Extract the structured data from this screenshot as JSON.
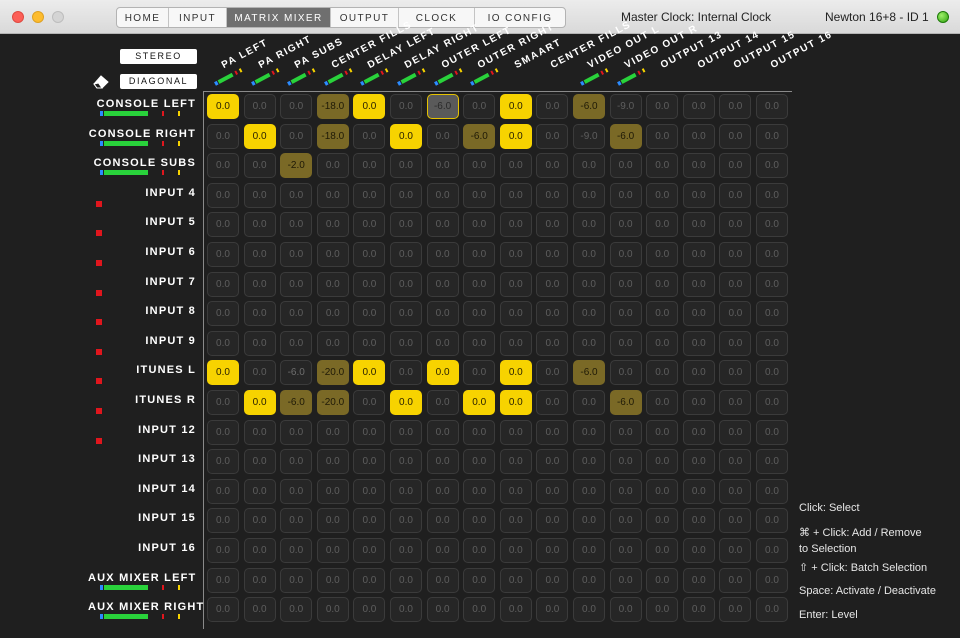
{
  "window": {
    "tabs": [
      "HOME",
      "INPUT",
      "MATRIX MIXER",
      "OUTPUT",
      "CLOCK",
      "IO CONFIG"
    ],
    "active_tab": "MATRIX MIXER",
    "master_clock": "Master Clock: Internal Clock",
    "device": "Newton 16+8 - ID 1"
  },
  "controls": {
    "stereo_label": "STEREO",
    "diagonal_label": "DIAGONAL"
  },
  "columns": [
    "PA LEFT",
    "PA RIGHT",
    "PA SUBS",
    "CENTER FILLS",
    "DELAY LEFT",
    "DELAY RIGHT",
    "OUTER LEFT",
    "OUTER RIGHT",
    "SMAART",
    "CENTER FILLS",
    "VIDEO OUT L",
    "VIDEO OUT R",
    "OUTPUT 13",
    "OUTPUT 14",
    "OUTPUT 15",
    "OUTPUT 16"
  ],
  "column_meters": [
    1,
    1,
    1,
    1,
    1,
    1,
    1,
    1,
    0,
    0,
    1,
    1,
    0,
    0,
    0,
    0
  ],
  "rows": [
    {
      "label": "CONSOLE LEFT",
      "meter": true,
      "mute": false,
      "cells": [
        "0.0",
        "0.0",
        "0.0",
        "-18.0",
        "0.0",
        "0.0",
        "-6.0",
        "0.0",
        "0.0",
        "0.0",
        "-6.0",
        "-9.0",
        "0.0",
        "0.0",
        "0.0",
        "0.0"
      ],
      "states": [
        "on",
        "",
        "",
        "dim",
        "on",
        "",
        "selgrey",
        "",
        "on",
        "",
        "dim",
        "",
        "",
        "",
        "",
        ""
      ]
    },
    {
      "label": "CONSOLE RIGHT",
      "meter": true,
      "mute": false,
      "cells": [
        "0.0",
        "0.0",
        "0.0",
        "-18.0",
        "0.0",
        "0.0",
        "0.0",
        "-6.0",
        "0.0",
        "0.0",
        "-9.0",
        "-6.0",
        "0.0",
        "0.0",
        "0.0",
        "0.0"
      ],
      "states": [
        "",
        "on",
        "",
        "dim",
        "",
        "on",
        "",
        "dim",
        "on",
        "",
        "",
        "dim",
        "",
        "",
        "",
        ""
      ]
    },
    {
      "label": "CONSOLE SUBS",
      "meter": true,
      "mute": false,
      "cells": [
        "0.0",
        "0.0",
        "-2.0",
        "0.0",
        "0.0",
        "0.0",
        "0.0",
        "0.0",
        "0.0",
        "0.0",
        "0.0",
        "0.0",
        "0.0",
        "0.0",
        "0.0",
        "0.0"
      ],
      "states": [
        "",
        "",
        "dim",
        "",
        "",
        "",
        "",
        "",
        "",
        "",
        "",
        "",
        "",
        "",
        "",
        ""
      ]
    },
    {
      "label": "INPUT 4",
      "meter": false,
      "mute": true,
      "cells": [
        "0.0",
        "0.0",
        "0.0",
        "0.0",
        "0.0",
        "0.0",
        "0.0",
        "0.0",
        "0.0",
        "0.0",
        "0.0",
        "0.0",
        "0.0",
        "0.0",
        "0.0",
        "0.0"
      ],
      "states": [
        "",
        "",
        "",
        "",
        "",
        "",
        "",
        "",
        "",
        "",
        "",
        "",
        "",
        "",
        "",
        ""
      ]
    },
    {
      "label": "INPUT 5",
      "meter": false,
      "mute": true,
      "cells": [
        "0.0",
        "0.0",
        "0.0",
        "0.0",
        "0.0",
        "0.0",
        "0.0",
        "0.0",
        "0.0",
        "0.0",
        "0.0",
        "0.0",
        "0.0",
        "0.0",
        "0.0",
        "0.0"
      ],
      "states": [
        "",
        "",
        "",
        "",
        "",
        "",
        "",
        "",
        "",
        "",
        "",
        "",
        "",
        "",
        "",
        ""
      ]
    },
    {
      "label": "INPUT 6",
      "meter": false,
      "mute": true,
      "cells": [
        "0.0",
        "0.0",
        "0.0",
        "0.0",
        "0.0",
        "0.0",
        "0.0",
        "0.0",
        "0.0",
        "0.0",
        "0.0",
        "0.0",
        "0.0",
        "0.0",
        "0.0",
        "0.0"
      ],
      "states": [
        "",
        "",
        "",
        "",
        "",
        "",
        "",
        "",
        "",
        "",
        "",
        "",
        "",
        "",
        "",
        ""
      ]
    },
    {
      "label": "INPUT 7",
      "meter": false,
      "mute": true,
      "cells": [
        "0.0",
        "0.0",
        "0.0",
        "0.0",
        "0.0",
        "0.0",
        "0.0",
        "0.0",
        "0.0",
        "0.0",
        "0.0",
        "0.0",
        "0.0",
        "0.0",
        "0.0",
        "0.0"
      ],
      "states": [
        "",
        "",
        "",
        "",
        "",
        "",
        "",
        "",
        "",
        "",
        "",
        "",
        "",
        "",
        "",
        ""
      ]
    },
    {
      "label": "INPUT 8",
      "meter": false,
      "mute": true,
      "cells": [
        "0.0",
        "0.0",
        "0.0",
        "0.0",
        "0.0",
        "0.0",
        "0.0",
        "0.0",
        "0.0",
        "0.0",
        "0.0",
        "0.0",
        "0.0",
        "0.0",
        "0.0",
        "0.0"
      ],
      "states": [
        "",
        "",
        "",
        "",
        "",
        "",
        "",
        "",
        "",
        "",
        "",
        "",
        "",
        "",
        "",
        ""
      ]
    },
    {
      "label": "INPUT 9",
      "meter": false,
      "mute": true,
      "cells": [
        "0.0",
        "0.0",
        "0.0",
        "0.0",
        "0.0",
        "0.0",
        "0.0",
        "0.0",
        "0.0",
        "0.0",
        "0.0",
        "0.0",
        "0.0",
        "0.0",
        "0.0",
        "0.0"
      ],
      "states": [
        "",
        "",
        "",
        "",
        "",
        "",
        "",
        "",
        "",
        "",
        "",
        "",
        "",
        "",
        "",
        ""
      ]
    },
    {
      "label": "ITUNES L",
      "meter": false,
      "mute": true,
      "cells": [
        "0.0",
        "0.0",
        "-6.0",
        "-20.0",
        "0.0",
        "0.0",
        "0.0",
        "0.0",
        "0.0",
        "0.0",
        "-6.0",
        "0.0",
        "0.0",
        "0.0",
        "0.0",
        "0.0"
      ],
      "states": [
        "on",
        "",
        "grey",
        "dim",
        "on",
        "",
        "on",
        "",
        "on",
        "",
        "dim",
        "",
        "",
        "",
        "",
        ""
      ]
    },
    {
      "label": "ITUNES R",
      "meter": false,
      "mute": true,
      "cells": [
        "0.0",
        "0.0",
        "-6.0",
        "-20.0",
        "0.0",
        "0.0",
        "0.0",
        "0.0",
        "0.0",
        "0.0",
        "0.0",
        "-6.0",
        "0.0",
        "0.0",
        "0.0",
        "0.0"
      ],
      "states": [
        "",
        "on",
        "dim",
        "dim",
        "",
        "on",
        "",
        "on",
        "on",
        "",
        "",
        "dim",
        "",
        "",
        "",
        ""
      ]
    },
    {
      "label": "INPUT 12",
      "meter": false,
      "mute": true,
      "cells": [
        "0.0",
        "0.0",
        "0.0",
        "0.0",
        "0.0",
        "0.0",
        "0.0",
        "0.0",
        "0.0",
        "0.0",
        "0.0",
        "0.0",
        "0.0",
        "0.0",
        "0.0",
        "0.0"
      ],
      "states": [
        "",
        "",
        "",
        "",
        "",
        "",
        "",
        "",
        "",
        "",
        "",
        "",
        "",
        "",
        "",
        ""
      ]
    },
    {
      "label": "INPUT 13",
      "meter": false,
      "mute": false,
      "cells": [
        "0.0",
        "0.0",
        "0.0",
        "0.0",
        "0.0",
        "0.0",
        "0.0",
        "0.0",
        "0.0",
        "0.0",
        "0.0",
        "0.0",
        "0.0",
        "0.0",
        "0.0",
        "0.0"
      ],
      "states": [
        "",
        "",
        "",
        "",
        "",
        "",
        "",
        "",
        "",
        "",
        "",
        "",
        "",
        "",
        "",
        ""
      ]
    },
    {
      "label": "INPUT 14",
      "meter": false,
      "mute": false,
      "cells": [
        "0.0",
        "0.0",
        "0.0",
        "0.0",
        "0.0",
        "0.0",
        "0.0",
        "0.0",
        "0.0",
        "0.0",
        "0.0",
        "0.0",
        "0.0",
        "0.0",
        "0.0",
        "0.0"
      ],
      "states": [
        "",
        "",
        "",
        "",
        "",
        "",
        "",
        "",
        "",
        "",
        "",
        "",
        "",
        "",
        "",
        ""
      ]
    },
    {
      "label": "INPUT 15",
      "meter": false,
      "mute": false,
      "cells": [
        "0.0",
        "0.0",
        "0.0",
        "0.0",
        "0.0",
        "0.0",
        "0.0",
        "0.0",
        "0.0",
        "0.0",
        "0.0",
        "0.0",
        "0.0",
        "0.0",
        "0.0",
        "0.0"
      ],
      "states": [
        "",
        "",
        "",
        "",
        "",
        "",
        "",
        "",
        "",
        "",
        "",
        "",
        "",
        "",
        "",
        ""
      ]
    },
    {
      "label": "INPUT 16",
      "meter": false,
      "mute": false,
      "cells": [
        "0.0",
        "0.0",
        "0.0",
        "0.0",
        "0.0",
        "0.0",
        "0.0",
        "0.0",
        "0.0",
        "0.0",
        "0.0",
        "0.0",
        "0.0",
        "0.0",
        "0.0",
        "0.0"
      ],
      "states": [
        "",
        "",
        "",
        "",
        "",
        "",
        "",
        "",
        "",
        "",
        "",
        "",
        "",
        "",
        "",
        ""
      ]
    },
    {
      "label": "AUX MIXER LEFT",
      "meter": true,
      "mute": false,
      "cells": [
        "0.0",
        "0.0",
        "0.0",
        "0.0",
        "0.0",
        "0.0",
        "0.0",
        "0.0",
        "0.0",
        "0.0",
        "0.0",
        "0.0",
        "0.0",
        "0.0",
        "0.0",
        "0.0"
      ],
      "states": [
        "",
        "",
        "",
        "",
        "",
        "",
        "",
        "",
        "",
        "",
        "",
        "",
        "",
        "",
        "",
        ""
      ]
    },
    {
      "label": "AUX MIXER RIGHT",
      "meter": true,
      "mute": false,
      "cells": [
        "0.0",
        "0.0",
        "0.0",
        "0.0",
        "0.0",
        "0.0",
        "0.0",
        "0.0",
        "0.0",
        "0.0",
        "0.0",
        "0.0",
        "0.0",
        "0.0",
        "0.0",
        "0.0"
      ],
      "states": [
        "",
        "",
        "",
        "",
        "",
        "",
        "",
        "",
        "",
        "",
        "",
        "",
        "",
        "",
        "",
        ""
      ]
    }
  ],
  "help": {
    "select": "Click: Select",
    "add_remove_1": "⌘ +  Click: Add / Remove",
    "add_remove_2": "to Selection",
    "batch": "⇧ + Click: Batch Selection",
    "space": "Space: Activate / Deactivate",
    "enter": "Enter: Level"
  },
  "colors": {
    "active": "#f7d300",
    "inactive_level": "#7a6926",
    "meter_green": "#29d23b",
    "meter_red": "#e0161d",
    "meter_yellow": "#f7d300",
    "meter_blue": "#2c8bff"
  }
}
